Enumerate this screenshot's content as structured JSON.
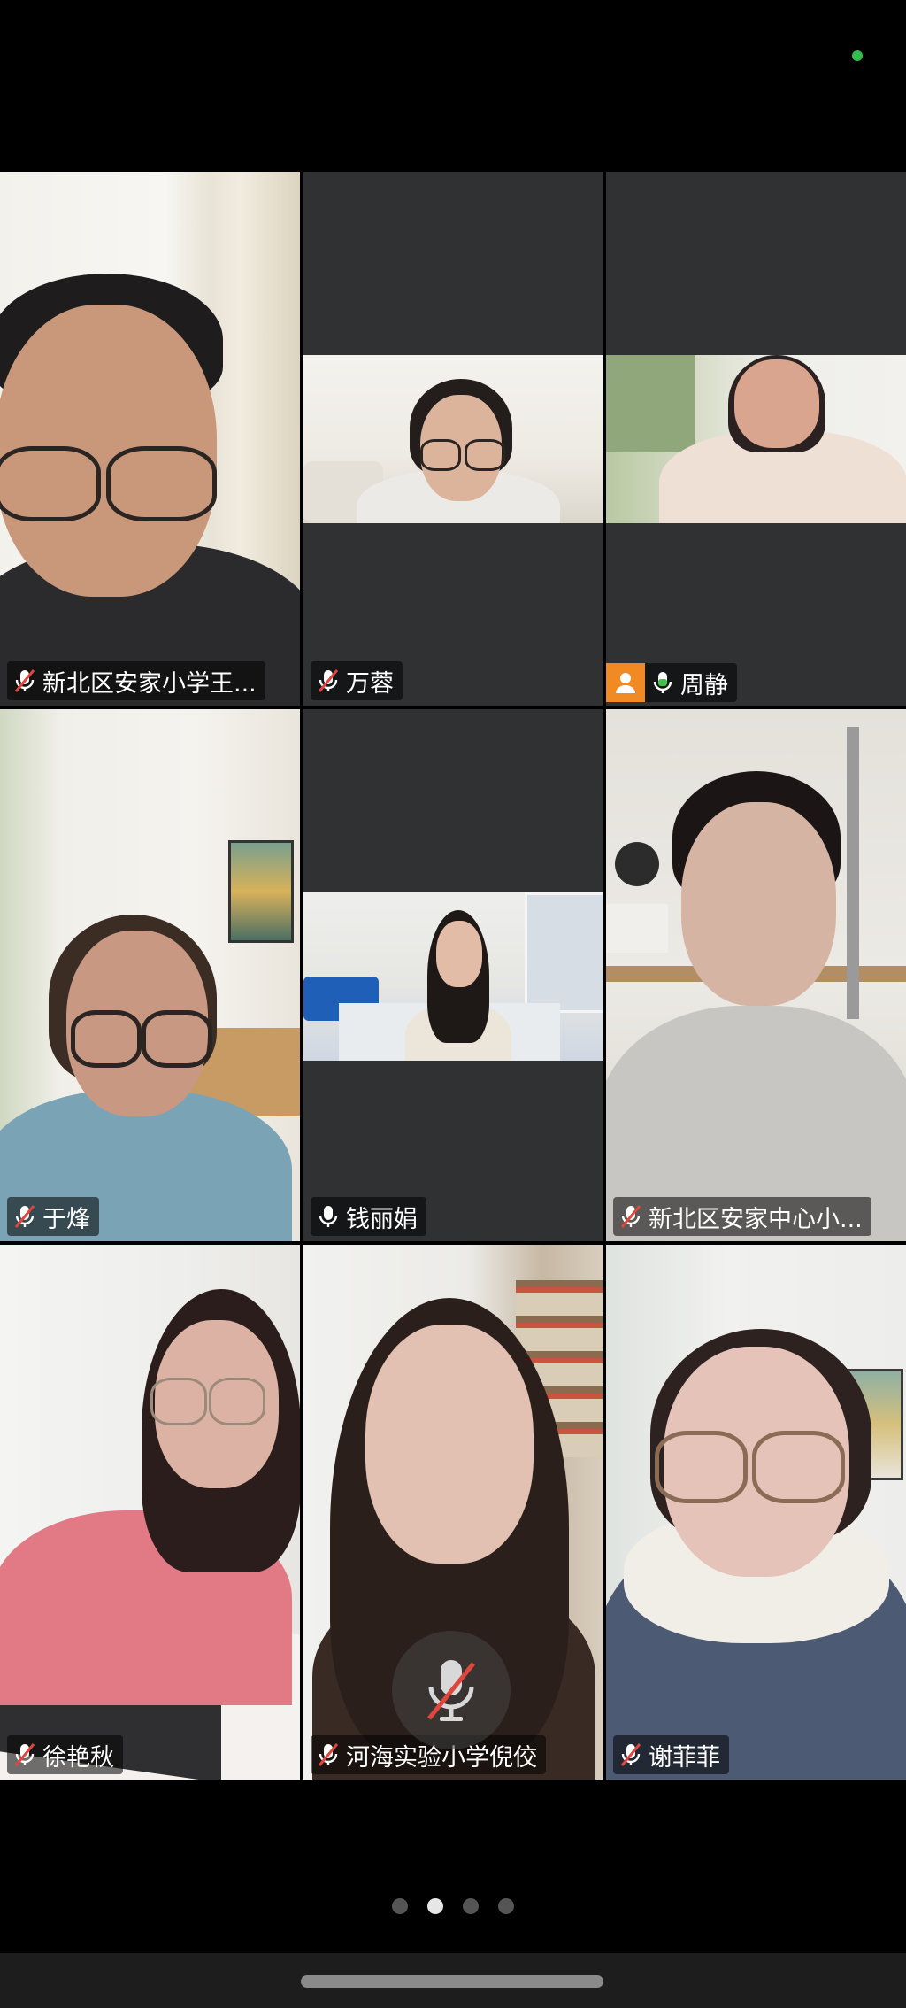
{
  "status": {
    "indicator_color": "#2fbf4a"
  },
  "participants": [
    {
      "name": "新北区安家小学王...",
      "mic": "muted",
      "video": "full"
    },
    {
      "name": "万蓉",
      "mic": "muted",
      "video": "band"
    },
    {
      "name": "周静",
      "mic": "active",
      "video": "band",
      "host_badge": "person-icon"
    },
    {
      "name": "于烽",
      "mic": "muted",
      "video": "full"
    },
    {
      "name": "钱丽娟",
      "mic": "on",
      "video": "band"
    },
    {
      "name": "新北区安家中心小...",
      "mic": "muted",
      "video": "full"
    },
    {
      "name": "徐艳秋",
      "mic": "muted",
      "video": "full"
    },
    {
      "name": "河海实验小学倪佼",
      "mic": "muted",
      "video": "full"
    },
    {
      "name": "谢菲菲",
      "mic": "muted",
      "video": "full"
    }
  ],
  "self_mic": {
    "state": "muted",
    "icon": "mic-off-icon"
  },
  "pager": {
    "pages": 4,
    "current": 2
  },
  "colors": {
    "mic_active": "#3ec24b",
    "muted_slash": "#e0463c",
    "host_badge": "#f18a22"
  }
}
